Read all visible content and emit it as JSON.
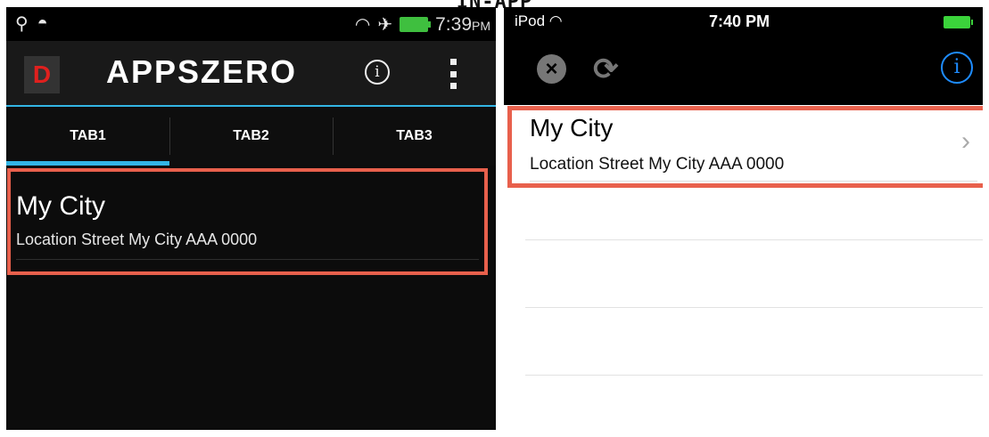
{
  "caption": "IN-APP",
  "android": {
    "status_time": "7:39",
    "status_ampm": "PM",
    "app_title": "APPSZERO",
    "logo_letter": "D",
    "tabs": [
      {
        "label": "TAB1"
      },
      {
        "label": "TAB2"
      },
      {
        "label": "TAB3"
      }
    ],
    "item": {
      "title": "My City",
      "subtitle": "Location Street My City AAA 0000"
    }
  },
  "ios": {
    "carrier": "iPod",
    "status_time": "7:40 PM",
    "item": {
      "title": "My City",
      "subtitle": "Location Street My City AAA 0000"
    }
  },
  "colors": {
    "highlight": "#e8604c",
    "android_accent": "#33b5e5",
    "ios_accent": "#1e8cff"
  }
}
